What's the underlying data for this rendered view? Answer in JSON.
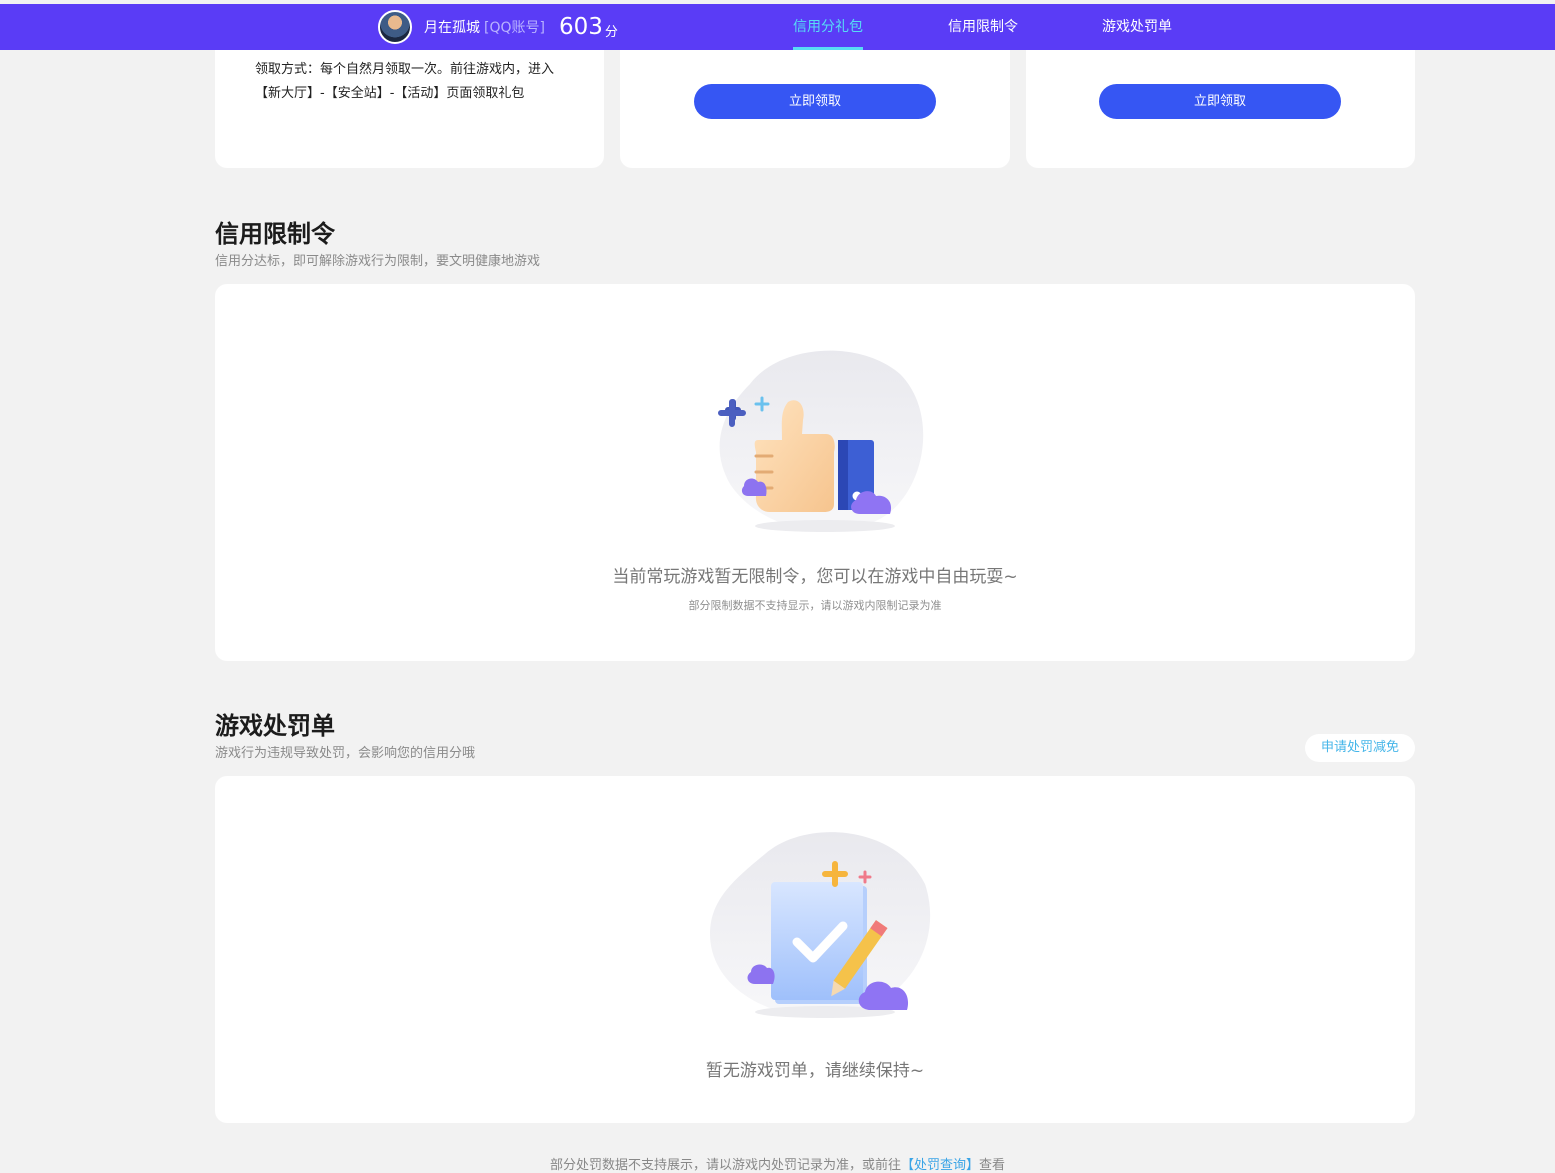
{
  "header": {
    "nickname": "月在孤城",
    "account_type": "[QQ账号]",
    "score": "603",
    "score_unit": "分",
    "tabs": [
      {
        "label": "信用分礼包",
        "active": true
      },
      {
        "label": "信用限制令",
        "active": false
      },
      {
        "label": "游戏处罚单",
        "active": false
      }
    ]
  },
  "gift": {
    "claim_method": "领取方式：每个自然月领取一次。前往游戏内，进入【新大厅】-【安全站】-【活动】页面领取礼包",
    "claim_button_1": "立即领取",
    "claim_button_2": "立即领取"
  },
  "restriction": {
    "title": "信用限制令",
    "subtitle": "信用分达标，即可解除游戏行为限制，要文明健康地游戏",
    "empty_text": "当前常玩游戏暂无限制令，您可以在游戏中自由玩耍~",
    "empty_note": "部分限制数据不支持显示，请以游戏内限制记录为准"
  },
  "penalty": {
    "title": "游戏处罚单",
    "subtitle": "游戏行为违规导致处罚，会影响您的信用分哦",
    "appeal_button": "申请处罚减免",
    "empty_text": "暂无游戏罚单，请继续保持~",
    "footer_prefix": "部分处罚数据不支持展示，请以游戏内处罚记录为准，或前往",
    "footer_link": "【处罚查询】",
    "footer_suffix": "查看"
  },
  "colors": {
    "header_bg": "#5a3cf6",
    "active_tab": "#57dcf5",
    "button": "#3656f3",
    "link": "#3aa4e6"
  }
}
